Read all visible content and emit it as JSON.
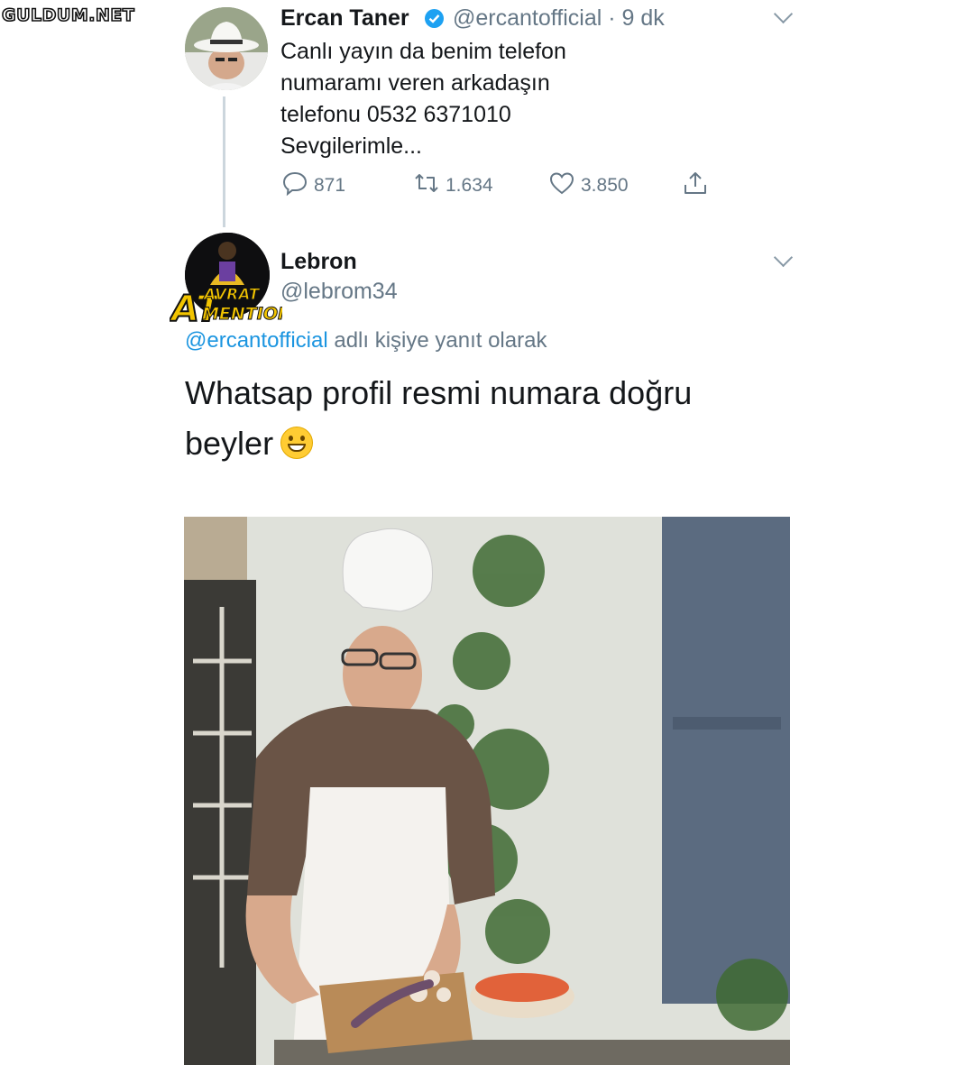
{
  "watermark": "GULDUM.NET",
  "tweet": {
    "author_name": "Ercan Taner",
    "author_handle": "@ercantofficial",
    "time": "· 9 dk",
    "lines": [
      "Canlı yayın da benim telefon",
      "numaramı veren arkadaşın",
      "telefonu  0532 6371010",
      "Sevgilerimle..."
    ],
    "replies": "871",
    "retweets": "1.634",
    "likes": "3.850"
  },
  "reply": {
    "author_name": "Lebron",
    "author_handle": "@lebrom34",
    "reply_to_handle": "@ercantofficial",
    "reply_to_suffix": " adlı kişiye yanıt olarak",
    "lines": [
      "Whatsap profil resmi numara doğru",
      "beyler"
    ],
    "logo_text": [
      "AT",
      "AVRAT",
      "MENTION"
    ]
  },
  "icons": {
    "verified": "verified-badge-icon",
    "reply": "reply-icon",
    "retweet": "retweet-icon",
    "like": "heart-icon",
    "share": "share-icon",
    "caret": "chevron-down-icon",
    "emoji": "grinning-face-icon"
  },
  "colors": {
    "link": "#1b95e0",
    "muted": "#657786",
    "verified": "#1da1f2"
  }
}
